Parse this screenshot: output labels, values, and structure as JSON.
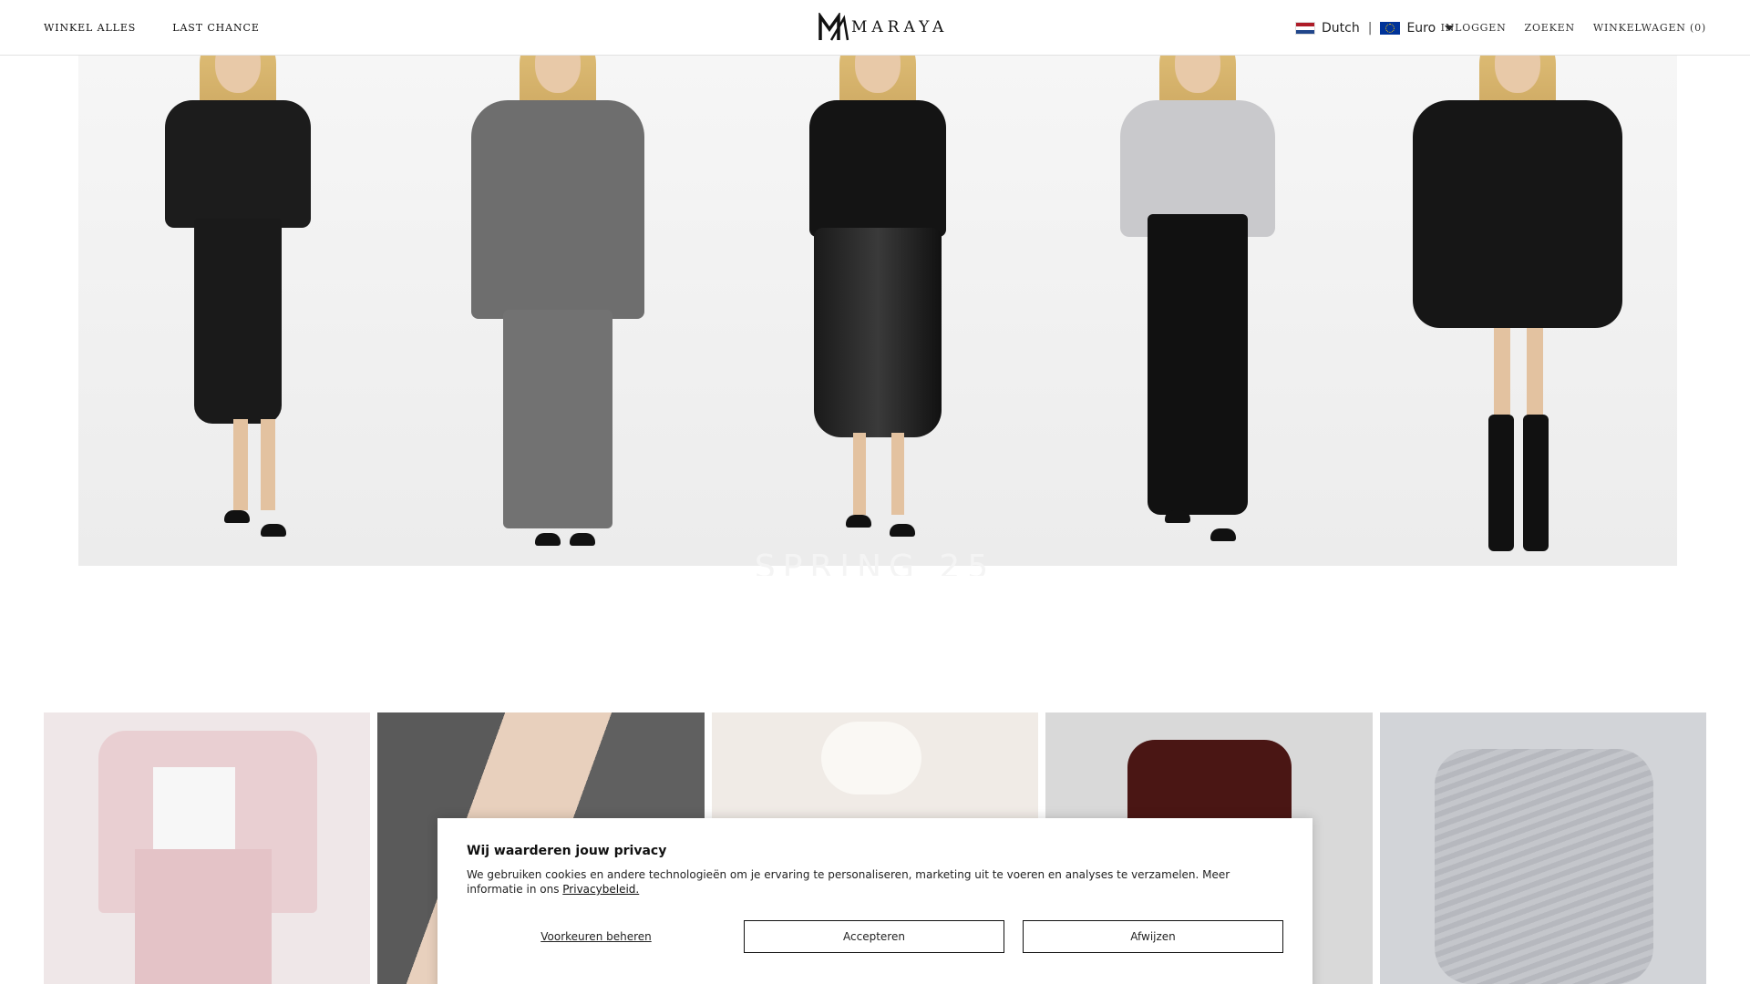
{
  "header": {
    "nav_left": [
      "WINKEL ALLES",
      "LAST CHANCE"
    ],
    "logo_text": "MARAYA",
    "language": "Dutch",
    "currency": "Euro",
    "nav_right": [
      "INLOGGEN",
      "ZOEKEN",
      "WINKELWAGEN (0)"
    ]
  },
  "hero": {
    "title": "SPRING 25"
  },
  "cookie_banner": {
    "title": "Wij waarderen jouw privacy",
    "text": "We gebruiken cookies en andere technologieën om je ervaring te personaliseren, marketing uit te voeren en analyses te verzamelen. Meer informatie in ons ",
    "link_text": "Privacybeleid.",
    "manage_label": "Voorkeuren beheren",
    "accept_label": "Accepteren",
    "reject_label": "Afwijzen"
  },
  "colors": {
    "text": "#111111",
    "border": "#e2e2e2",
    "hero_bg": "#f2f2f2"
  }
}
